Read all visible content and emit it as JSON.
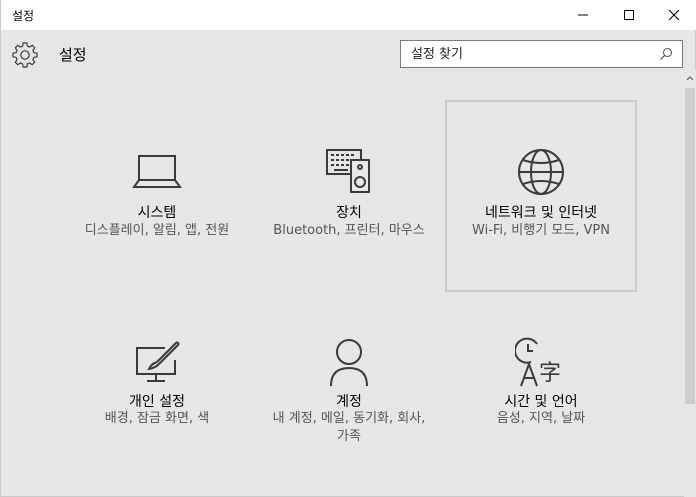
{
  "window": {
    "title": "설정"
  },
  "header": {
    "title": "설정",
    "search_placeholder": "설정 찾기",
    "search_value": ""
  },
  "tiles": [
    {
      "id": "system",
      "title": "시스템",
      "description": "디스플레이, 알림, 앱, 전원",
      "icon": "laptop-icon"
    },
    {
      "id": "devices",
      "title": "장치",
      "description": "Bluetooth, 프린터, 마우스",
      "icon": "devices-icon"
    },
    {
      "id": "network",
      "title": "네트워크 및 인터넷",
      "description": "Wi-Fi, 비행기 모드, VPN",
      "icon": "globe-icon",
      "focused": true
    },
    {
      "id": "personalization",
      "title": "개인 설정",
      "description": "배경, 잠금 화면, 색",
      "icon": "personalization-icon"
    },
    {
      "id": "accounts",
      "title": "계정",
      "description": "내 계정, 메일, 동기화, 회사, 가족",
      "icon": "person-icon"
    },
    {
      "id": "time-language",
      "title": "시간 및 언어",
      "description": "음성, 지역, 날짜",
      "icon": "time-language-icon"
    }
  ],
  "colors": {
    "background": "#e6e6e6",
    "icon": "#3a3a3a",
    "description": "#555555",
    "focus_border": "#cbcbcb"
  }
}
